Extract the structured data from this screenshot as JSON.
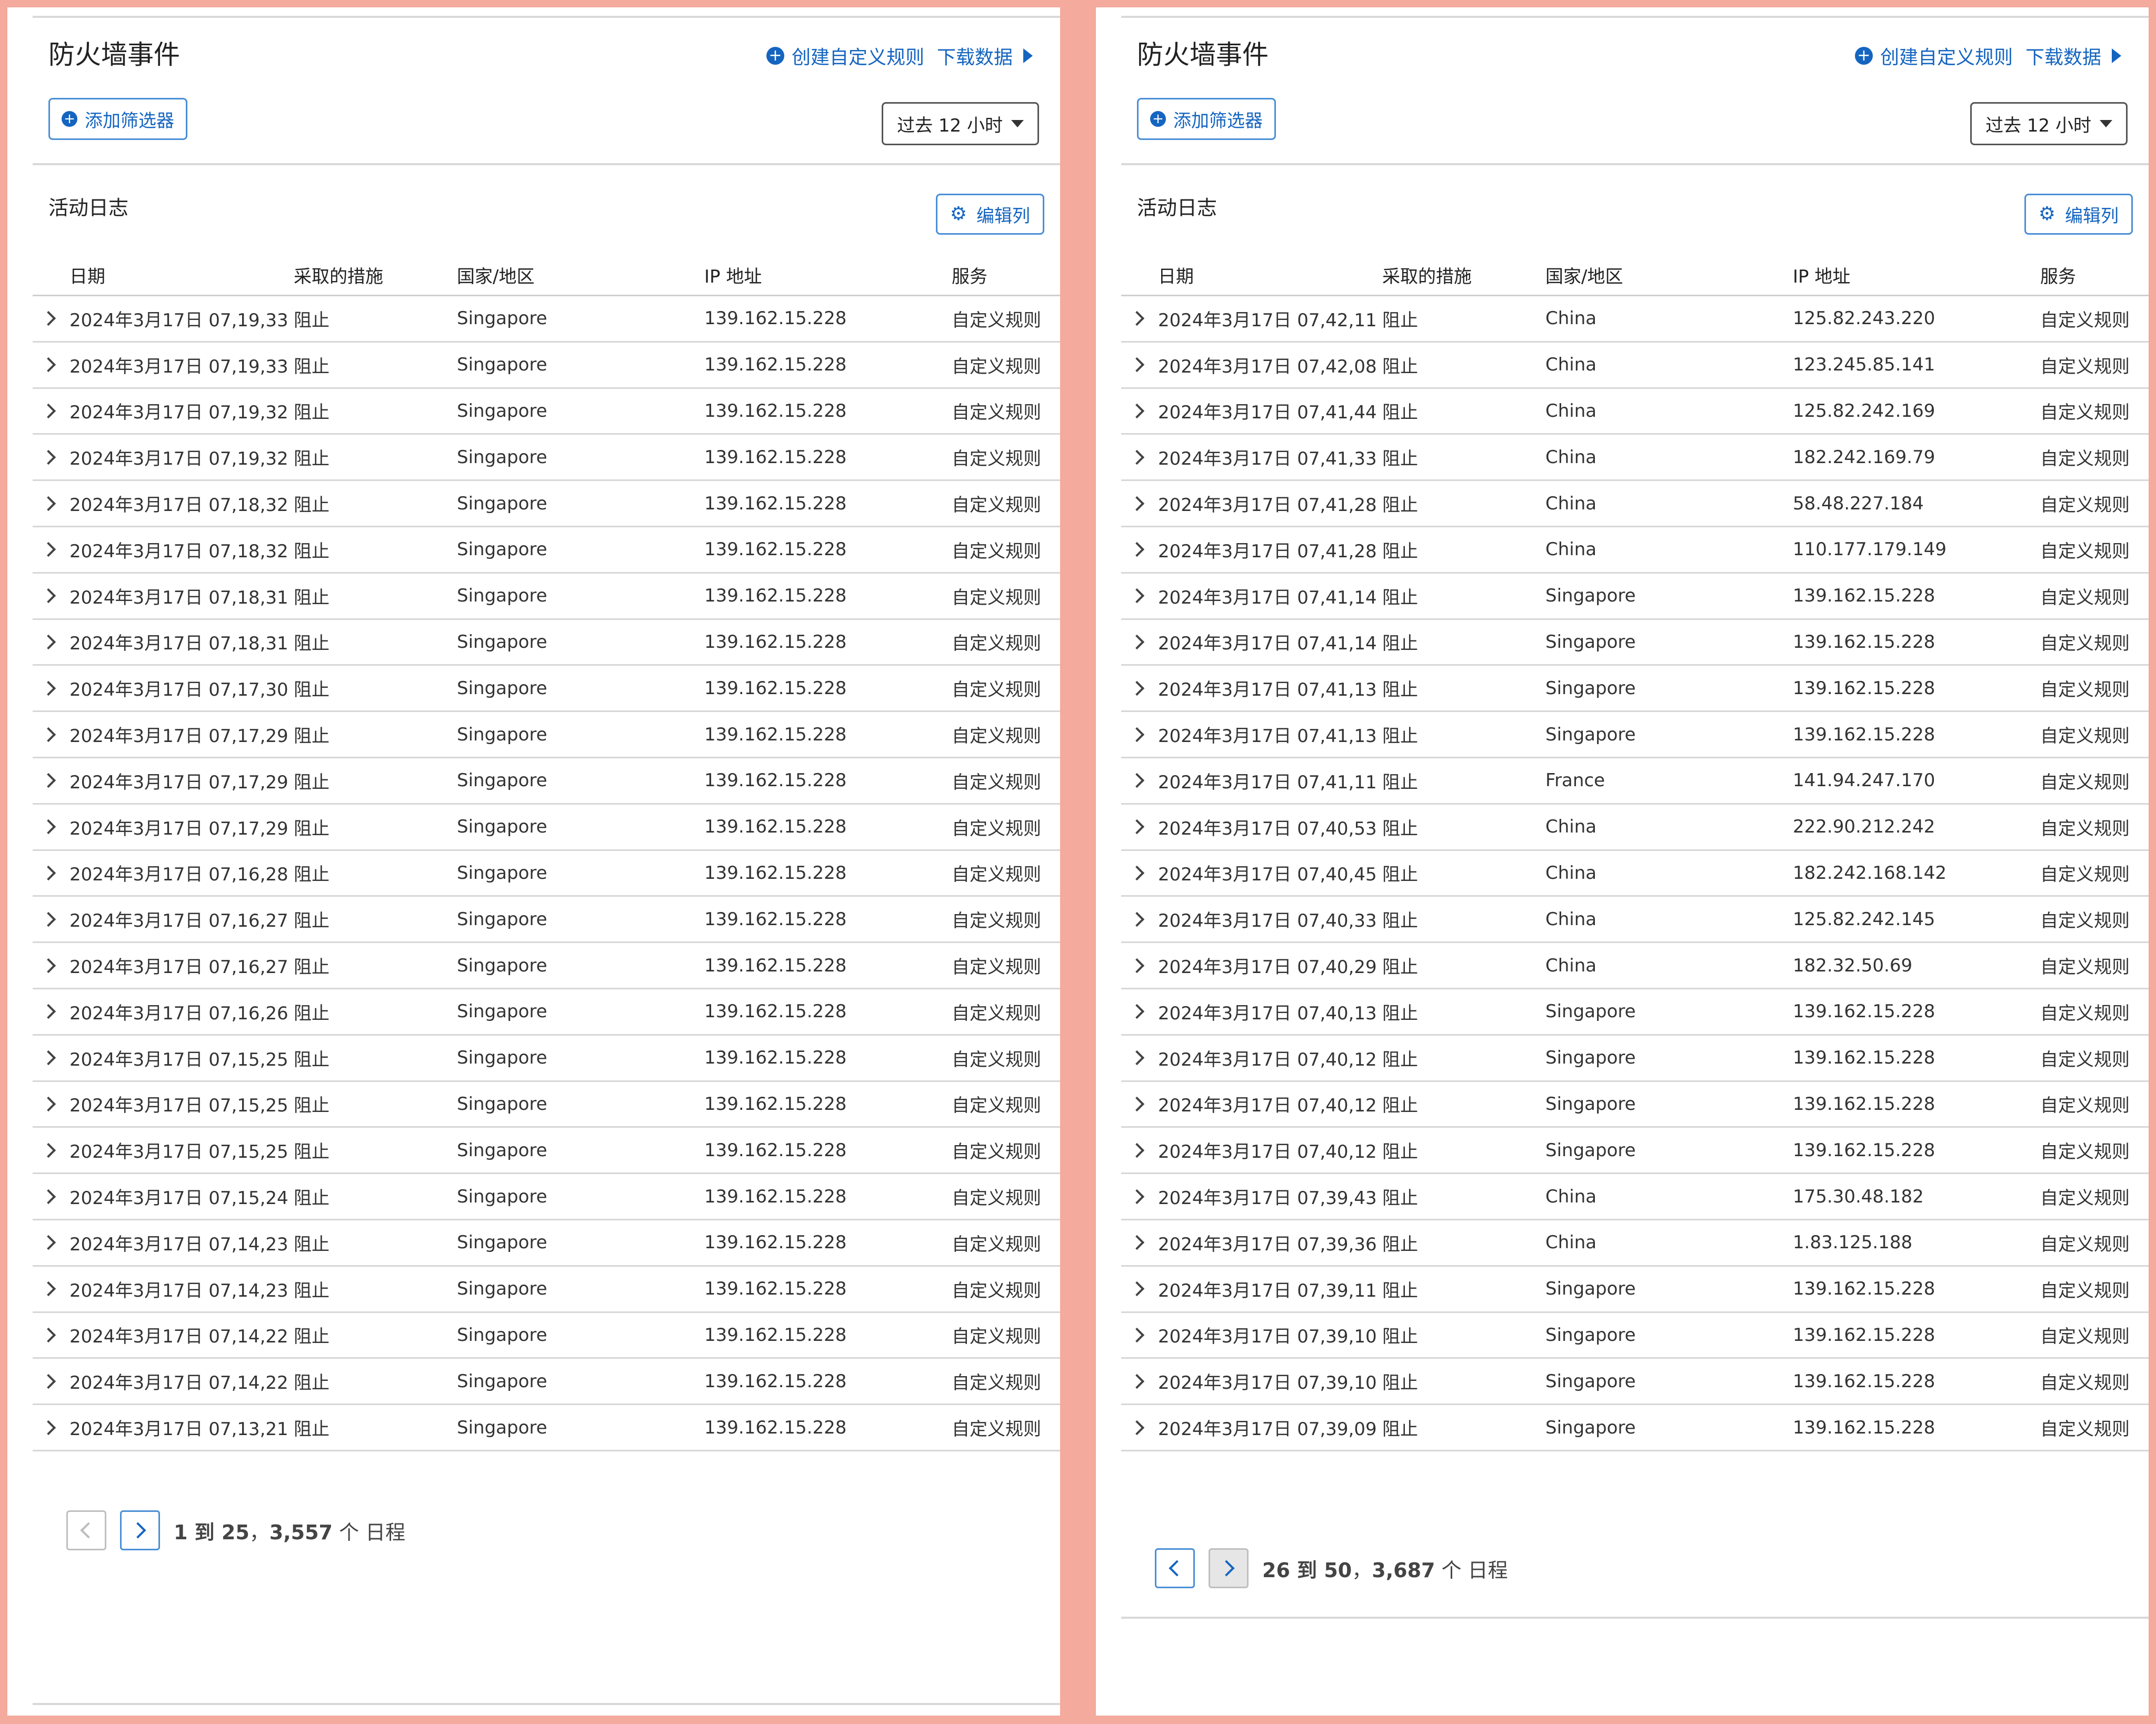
{
  "header": {
    "title": "防火墙事件",
    "create_rule_label": "创建自定义规则",
    "download_label": "下载数据"
  },
  "filters": {
    "add_filter_label": "添加筛选器",
    "time_range": "过去 12 小时"
  },
  "activity": {
    "section_title": "活动日志",
    "edit_columns_label": "编辑列"
  },
  "columns": {
    "date": "日期",
    "action": "采取的措施",
    "country": "国家/地区",
    "ip": "IP 地址",
    "service": "服务"
  },
  "left_page": {
    "rows": [
      {
        "date": "2024年3月17日 07,19,33",
        "action": "阻止",
        "country": "Singapore",
        "ip": "139.162.15.228",
        "service": "自定义规则"
      },
      {
        "date": "2024年3月17日 07,19,33",
        "action": "阻止",
        "country": "Singapore",
        "ip": "139.162.15.228",
        "service": "自定义规则"
      },
      {
        "date": "2024年3月17日 07,19,32",
        "action": "阻止",
        "country": "Singapore",
        "ip": "139.162.15.228",
        "service": "自定义规则"
      },
      {
        "date": "2024年3月17日 07,19,32",
        "action": "阻止",
        "country": "Singapore",
        "ip": "139.162.15.228",
        "service": "自定义规则"
      },
      {
        "date": "2024年3月17日 07,18,32",
        "action": "阻止",
        "country": "Singapore",
        "ip": "139.162.15.228",
        "service": "自定义规则"
      },
      {
        "date": "2024年3月17日 07,18,32",
        "action": "阻止",
        "country": "Singapore",
        "ip": "139.162.15.228",
        "service": "自定义规则"
      },
      {
        "date": "2024年3月17日 07,18,31",
        "action": "阻止",
        "country": "Singapore",
        "ip": "139.162.15.228",
        "service": "自定义规则"
      },
      {
        "date": "2024年3月17日 07,18,31",
        "action": "阻止",
        "country": "Singapore",
        "ip": "139.162.15.228",
        "service": "自定义规则"
      },
      {
        "date": "2024年3月17日 07,17,30",
        "action": "阻止",
        "country": "Singapore",
        "ip": "139.162.15.228",
        "service": "自定义规则"
      },
      {
        "date": "2024年3月17日 07,17,29",
        "action": "阻止",
        "country": "Singapore",
        "ip": "139.162.15.228",
        "service": "自定义规则"
      },
      {
        "date": "2024年3月17日 07,17,29",
        "action": "阻止",
        "country": "Singapore",
        "ip": "139.162.15.228",
        "service": "自定义规则"
      },
      {
        "date": "2024年3月17日 07,17,29",
        "action": "阻止",
        "country": "Singapore",
        "ip": "139.162.15.228",
        "service": "自定义规则"
      },
      {
        "date": "2024年3月17日 07,16,28",
        "action": "阻止",
        "country": "Singapore",
        "ip": "139.162.15.228",
        "service": "自定义规则"
      },
      {
        "date": "2024年3月17日 07,16,27",
        "action": "阻止",
        "country": "Singapore",
        "ip": "139.162.15.228",
        "service": "自定义规则"
      },
      {
        "date": "2024年3月17日 07,16,27",
        "action": "阻止",
        "country": "Singapore",
        "ip": "139.162.15.228",
        "service": "自定义规则"
      },
      {
        "date": "2024年3月17日 07,16,26",
        "action": "阻止",
        "country": "Singapore",
        "ip": "139.162.15.228",
        "service": "自定义规则"
      },
      {
        "date": "2024年3月17日 07,15,25",
        "action": "阻止",
        "country": "Singapore",
        "ip": "139.162.15.228",
        "service": "自定义规则"
      },
      {
        "date": "2024年3月17日 07,15,25",
        "action": "阻止",
        "country": "Singapore",
        "ip": "139.162.15.228",
        "service": "自定义规则"
      },
      {
        "date": "2024年3月17日 07,15,25",
        "action": "阻止",
        "country": "Singapore",
        "ip": "139.162.15.228",
        "service": "自定义规则"
      },
      {
        "date": "2024年3月17日 07,15,24",
        "action": "阻止",
        "country": "Singapore",
        "ip": "139.162.15.228",
        "service": "自定义规则"
      },
      {
        "date": "2024年3月17日 07,14,23",
        "action": "阻止",
        "country": "Singapore",
        "ip": "139.162.15.228",
        "service": "自定义规则"
      },
      {
        "date": "2024年3月17日 07,14,23",
        "action": "阻止",
        "country": "Singapore",
        "ip": "139.162.15.228",
        "service": "自定义规则"
      },
      {
        "date": "2024年3月17日 07,14,22",
        "action": "阻止",
        "country": "Singapore",
        "ip": "139.162.15.228",
        "service": "自定义规则"
      },
      {
        "date": "2024年3月17日 07,14,22",
        "action": "阻止",
        "country": "Singapore",
        "ip": "139.162.15.228",
        "service": "自定义规则"
      },
      {
        "date": "2024年3月17日 07,13,21",
        "action": "阻止",
        "country": "Singapore",
        "ip": "139.162.15.228",
        "service": "自定义规则"
      }
    ],
    "pagination": {
      "range": "1 到 25",
      "total": "3,557",
      "suffix": "个 日程"
    }
  },
  "right_page": {
    "rows": [
      {
        "date": "2024年3月17日 07,42,11",
        "action": "阻止",
        "country": "China",
        "ip": "125.82.243.220",
        "service": "自定义规则"
      },
      {
        "date": "2024年3月17日 07,42,08",
        "action": "阻止",
        "country": "China",
        "ip": "123.245.85.141",
        "service": "自定义规则"
      },
      {
        "date": "2024年3月17日 07,41,44",
        "action": "阻止",
        "country": "China",
        "ip": "125.82.242.169",
        "service": "自定义规则"
      },
      {
        "date": "2024年3月17日 07,41,33",
        "action": "阻止",
        "country": "China",
        "ip": "182.242.169.79",
        "service": "自定义规则"
      },
      {
        "date": "2024年3月17日 07,41,28",
        "action": "阻止",
        "country": "China",
        "ip": "58.48.227.184",
        "service": "自定义规则"
      },
      {
        "date": "2024年3月17日 07,41,28",
        "action": "阻止",
        "country": "China",
        "ip": "110.177.179.149",
        "service": "自定义规则"
      },
      {
        "date": "2024年3月17日 07,41,14",
        "action": "阻止",
        "country": "Singapore",
        "ip": "139.162.15.228",
        "service": "自定义规则"
      },
      {
        "date": "2024年3月17日 07,41,14",
        "action": "阻止",
        "country": "Singapore",
        "ip": "139.162.15.228",
        "service": "自定义规则"
      },
      {
        "date": "2024年3月17日 07,41,13",
        "action": "阻止",
        "country": "Singapore",
        "ip": "139.162.15.228",
        "service": "自定义规则"
      },
      {
        "date": "2024年3月17日 07,41,13",
        "action": "阻止",
        "country": "Singapore",
        "ip": "139.162.15.228",
        "service": "自定义规则"
      },
      {
        "date": "2024年3月17日 07,41,11",
        "action": "阻止",
        "country": "France",
        "ip": "141.94.247.170",
        "service": "自定义规则"
      },
      {
        "date": "2024年3月17日 07,40,53",
        "action": "阻止",
        "country": "China",
        "ip": "222.90.212.242",
        "service": "自定义规则"
      },
      {
        "date": "2024年3月17日 07,40,45",
        "action": "阻止",
        "country": "China",
        "ip": "182.242.168.142",
        "service": "自定义规则"
      },
      {
        "date": "2024年3月17日 07,40,33",
        "action": "阻止",
        "country": "China",
        "ip": "125.82.242.145",
        "service": "自定义规则"
      },
      {
        "date": "2024年3月17日 07,40,29",
        "action": "阻止",
        "country": "China",
        "ip": "182.32.50.69",
        "service": "自定义规则"
      },
      {
        "date": "2024年3月17日 07,40,13",
        "action": "阻止",
        "country": "Singapore",
        "ip": "139.162.15.228",
        "service": "自定义规则"
      },
      {
        "date": "2024年3月17日 07,40,12",
        "action": "阻止",
        "country": "Singapore",
        "ip": "139.162.15.228",
        "service": "自定义规则"
      },
      {
        "date": "2024年3月17日 07,40,12",
        "action": "阻止",
        "country": "Singapore",
        "ip": "139.162.15.228",
        "service": "自定义规则"
      },
      {
        "date": "2024年3月17日 07,40,12",
        "action": "阻止",
        "country": "Singapore",
        "ip": "139.162.15.228",
        "service": "自定义规则"
      },
      {
        "date": "2024年3月17日 07,39,43",
        "action": "阻止",
        "country": "China",
        "ip": "175.30.48.182",
        "service": "自定义规则"
      },
      {
        "date": "2024年3月17日 07,39,36",
        "action": "阻止",
        "country": "China",
        "ip": "1.83.125.188",
        "service": "自定义规则"
      },
      {
        "date": "2024年3月17日 07,39,11",
        "action": "阻止",
        "country": "Singapore",
        "ip": "139.162.15.228",
        "service": "自定义规则"
      },
      {
        "date": "2024年3月17日 07,39,10",
        "action": "阻止",
        "country": "Singapore",
        "ip": "139.162.15.228",
        "service": "自定义规则"
      },
      {
        "date": "2024年3月17日 07,39,10",
        "action": "阻止",
        "country": "Singapore",
        "ip": "139.162.15.228",
        "service": "自定义规则"
      },
      {
        "date": "2024年3月17日 07,39,09",
        "action": "阻止",
        "country": "Singapore",
        "ip": "139.162.15.228",
        "service": "自定义规则"
      }
    ],
    "pagination": {
      "range": "26 到 50",
      "total": "3,687",
      "suffix": "个 日程"
    }
  },
  "colors": {
    "accent": "#1565c0",
    "frame": "#f4aa9c"
  },
  "icons": {
    "create": "plus-circle-icon",
    "download": "triangle-right-icon",
    "filter": "plus-circle-icon",
    "time_caret": "caret-down-icon",
    "edit": "gear-icon",
    "expand": "chevron-right-icon",
    "prev": "chevron-left-icon",
    "next": "chevron-right-icon"
  }
}
